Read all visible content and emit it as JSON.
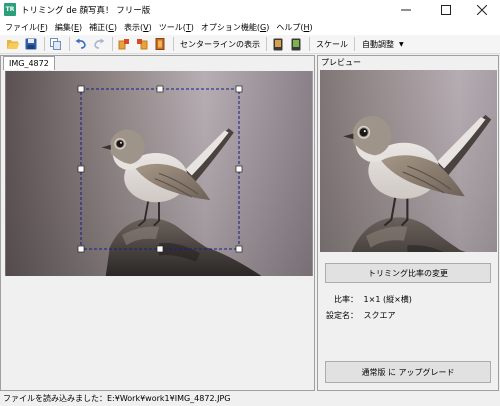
{
  "window": {
    "title": "トリミング de 顔写真！ フリー版",
    "icon_label": "TR"
  },
  "menu": [
    {
      "label": "ファイル(",
      "key": "F",
      "close": ")"
    },
    {
      "label": "編集(",
      "key": "E",
      "close": ")"
    },
    {
      "label": "補正(",
      "key": "C",
      "close": ")"
    },
    {
      "label": "表示(",
      "key": "V",
      "close": ")"
    },
    {
      "label": "ツール(",
      "key": "T",
      "close": ")"
    },
    {
      "label": "オプション機能(",
      "key": "G",
      "close": ")"
    },
    {
      "label": "ヘルプ(",
      "key": "H",
      "close": ")"
    }
  ],
  "toolbar": {
    "centerline_label": "センターラインの表示",
    "scale_label": "スケール",
    "adjust_label": "自動調整"
  },
  "image_tab": "IMG_4872",
  "preview": {
    "label": "プレビュー",
    "change_ratio_button": "トリミング比率の変更",
    "ratio_label": "比率：",
    "ratio_value": "1×1 (縦×横)",
    "setting_label": "設定名：",
    "setting_value": "スクエア",
    "upgrade_button": "通常版 に アップグレード"
  },
  "status": "ファイルを読み込みました：E:¥Work¥work1¥IMG_4872.JPG",
  "colors": {
    "crop_border": "#1a1a8a",
    "app_icon": "#2aa07a",
    "bird_body": "#d8d2cc",
    "bird_wing": "#8a7d70"
  }
}
